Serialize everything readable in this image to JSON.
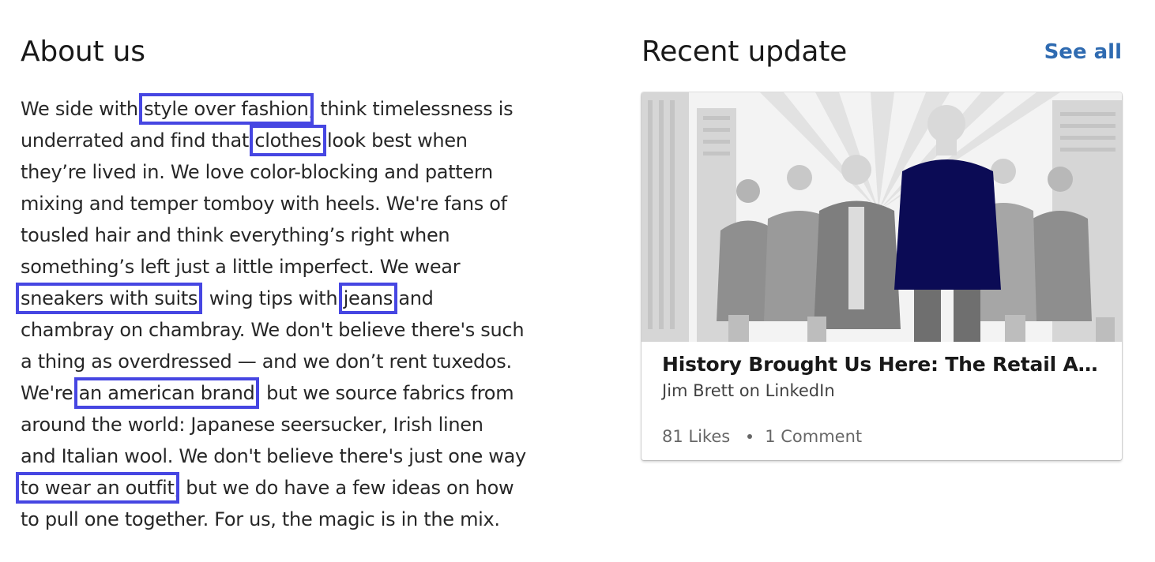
{
  "about": {
    "title": "About us",
    "text": {
      "t1": "We side with ",
      "h1": "style over fashion",
      "t2": ", think timelessness is",
      "t3": "underrated and find that ",
      "h2": "clothes",
      "t4": " look  best when",
      "t5": "they’re lived in. We love color-blocking and pattern",
      "t6": "mixing and temper tomboy with heels. We're fans of",
      "t7": "tousled hair and think everything’s right when",
      "t8": "something’s left just a little imperfect. We wear",
      "h3": "sneakers with suits",
      "t9": ", wing tips with ",
      "h4": "jeans",
      "t10": " and",
      "t11": "chambray on chambray. We don't believe there's such",
      "t12": "a thing as overdressed — and we don’t rent tuxedos.",
      "t13": "We're ",
      "h5": "an american brand",
      "t14": ", but we source fabrics from",
      "t15": "around the world: Japanese seersucker, Irish linen",
      "t16": "and Italian wool. We don't believe there's just one way",
      "h6": "to wear an outfit",
      "t17": ", but we do have a few ideas on how",
      "t18": "to pull one together. For us, the magic is in the mix."
    },
    "highlight_color": "#4646e2"
  },
  "recent": {
    "title": "Recent update",
    "see_all": "See all",
    "card": {
      "image_icon": "business-people-illustration",
      "title": "History Brought Us Here: The Retail A…",
      "author": "Jim Brett on LinkedIn",
      "likes": "81 Likes",
      "comments": "1 Comment"
    }
  },
  "colors": {
    "link": "#2f6bb1",
    "highlight": "#4646e2",
    "suit_navy": "#0b0b55"
  }
}
